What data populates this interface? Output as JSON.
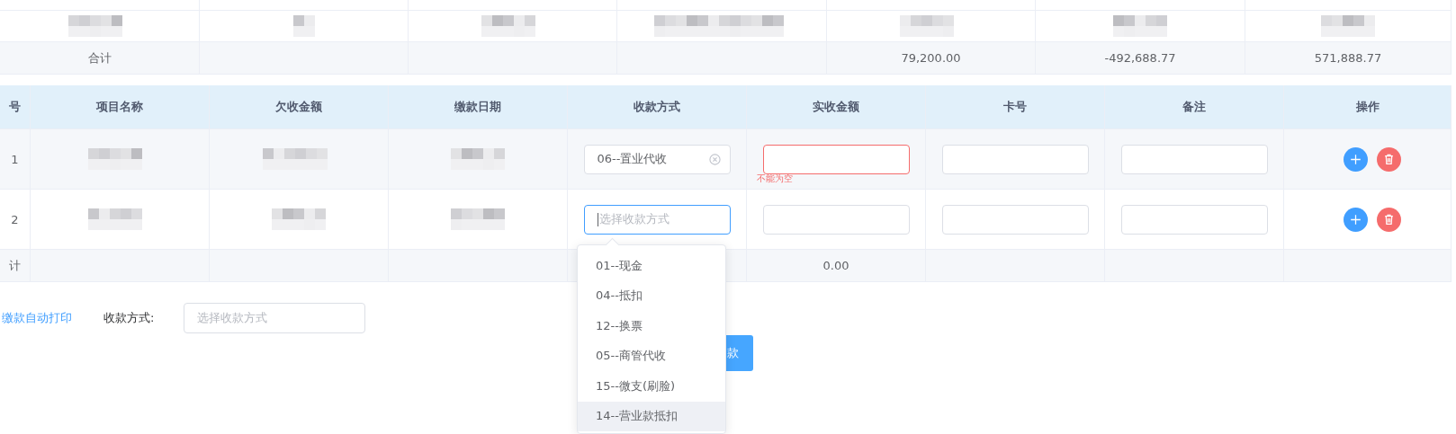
{
  "summary_table": {
    "total_row": {
      "label": "合计",
      "column_5": "79,200.00",
      "column_6": "-492,688.77",
      "column_7": "571,888.77"
    }
  },
  "payment_table": {
    "columns": [
      "号",
      "项目名称",
      "欠收金额",
      "缴款日期",
      "收款方式",
      "实收金额",
      "卡号",
      "备注",
      "操作"
    ],
    "rows": [
      {
        "index": "1",
        "method": {
          "value": "06--置业代收",
          "clearable": true,
          "focused": false
        },
        "amount": {
          "invalid": true,
          "error": "不能为空"
        }
      },
      {
        "index": "2",
        "method": {
          "placeholder": "选择收款方式",
          "clearable": false,
          "focused": true
        },
        "amount": {
          "invalid": false
        }
      }
    ],
    "total_row": {
      "label": "计",
      "amount": "0.00"
    }
  },
  "dropdown": {
    "options": [
      {
        "label": "01--现金",
        "hovered": false
      },
      {
        "label": "04--抵扣",
        "hovered": false
      },
      {
        "label": "12--换票",
        "hovered": false
      },
      {
        "label": "05--商管代收",
        "hovered": false
      },
      {
        "label": "15--微支(刷脸)",
        "hovered": false
      },
      {
        "label": "14--营业款抵扣",
        "hovered": true
      }
    ]
  },
  "footer": {
    "auto_print_link": "缴款自动打印",
    "method_label": "收款方式:",
    "method_field": {
      "placeholder": "选择收款方式"
    },
    "submit_button": "款"
  }
}
